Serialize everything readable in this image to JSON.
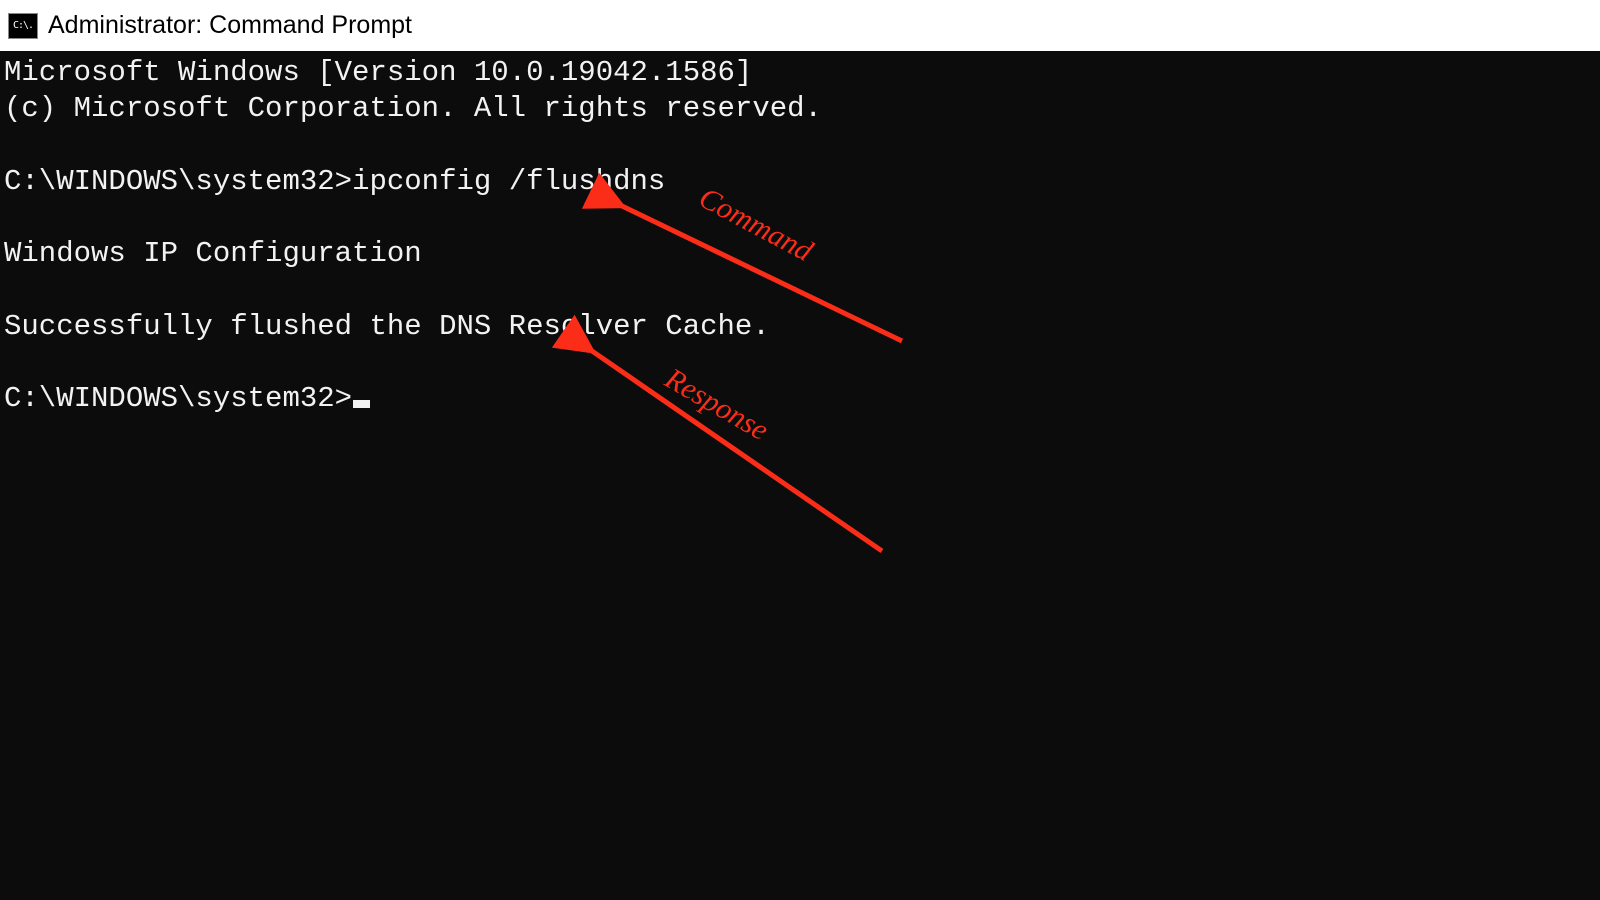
{
  "window": {
    "icon_label": "C:\\.",
    "title": "Administrator: Command Prompt"
  },
  "terminal": {
    "banner_version": "Microsoft Windows [Version 10.0.19042.1586]",
    "banner_copyright": "(c) Microsoft Corporation. All rights reserved.",
    "prompt1": "C:\\WINDOWS\\system32>",
    "command1": "ipconfig /flushdns",
    "output_heading": "Windows IP Configuration",
    "output_result": "Successfully flushed the DNS Resolver Cache.",
    "prompt2": "C:\\WINDOWS\\system32>"
  },
  "annotations": {
    "command_label": "Command",
    "response_label": "Response",
    "color": "#fb2d18"
  }
}
